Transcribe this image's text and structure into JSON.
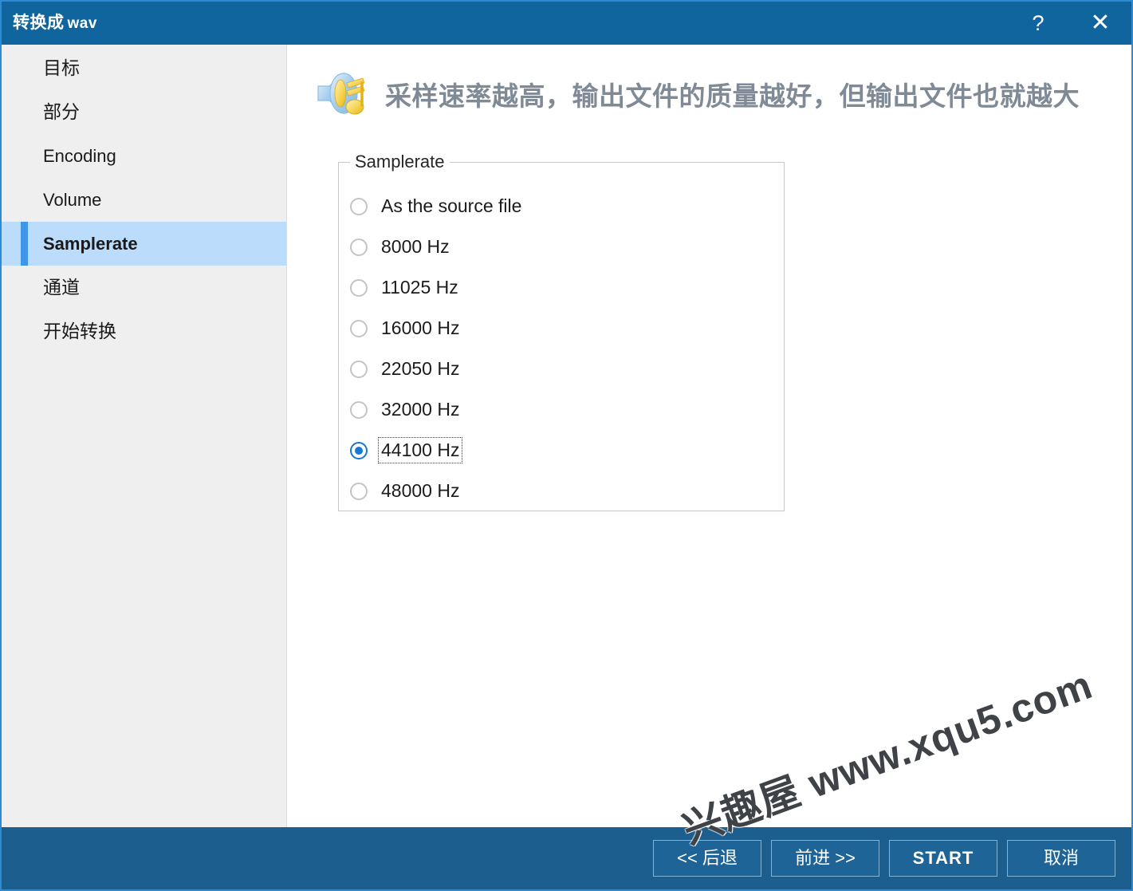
{
  "window": {
    "title_main": "转换成",
    "title_ext": "wav",
    "help_icon": "?",
    "close_icon": "✕",
    "accent_color": "#11659e",
    "footer_color": "#1c5e8e",
    "selection_color": "#bcdcfb"
  },
  "sidebar": {
    "items": [
      {
        "label": "目标",
        "active": false
      },
      {
        "label": "部分",
        "active": false
      },
      {
        "label": "Encoding",
        "active": false
      },
      {
        "label": "Volume",
        "active": false
      },
      {
        "label": "Samplerate",
        "active": true
      },
      {
        "label": "通道",
        "active": false
      },
      {
        "label": "开始转换",
        "active": false
      }
    ]
  },
  "hero": {
    "icon": "speaker-music-note-icon",
    "text": "采样速率越高，输出文件的质量越好，但输出文件也就越大"
  },
  "groupbox": {
    "legend": "Samplerate",
    "options": [
      {
        "label": "As the source file",
        "checked": false,
        "focused": false
      },
      {
        "label": "8000 Hz",
        "checked": false,
        "focused": false
      },
      {
        "label": "11025 Hz",
        "checked": false,
        "focused": false
      },
      {
        "label": "16000 Hz",
        "checked": false,
        "focused": false
      },
      {
        "label": "22050 Hz",
        "checked": false,
        "focused": false
      },
      {
        "label": "32000 Hz",
        "checked": false,
        "focused": false
      },
      {
        "label": "44100 Hz",
        "checked": true,
        "focused": true
      },
      {
        "label": "48000 Hz",
        "checked": false,
        "focused": false
      }
    ],
    "selected_value": "44100 Hz"
  },
  "footer": {
    "buttons": [
      {
        "label": "<< 后退",
        "primary": false
      },
      {
        "label": "前进 >>",
        "primary": false
      },
      {
        "label": "START",
        "primary": true
      },
      {
        "label": "取消",
        "primary": false
      }
    ]
  },
  "watermark": {
    "text": "兴趣屋 www.xqu5.com"
  }
}
